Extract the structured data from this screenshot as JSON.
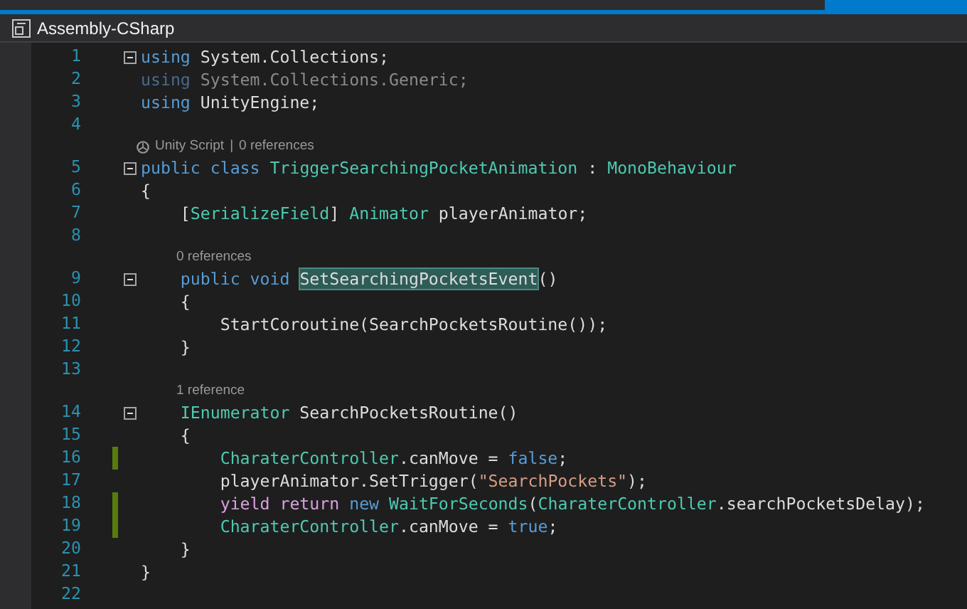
{
  "project_bar": {
    "title": "Assembly-CSharp"
  },
  "lines": [
    {
      "number": "1",
      "fold_marker": true,
      "changed": false,
      "tokens": [
        {
          "kind": "keyword",
          "text": "using"
        },
        {
          "kind": "plain",
          "text": " System.Collections;"
        }
      ]
    },
    {
      "number": "2",
      "fold_marker": false,
      "changed": false,
      "tokens": [
        {
          "kind": "unused",
          "text": "using"
        },
        {
          "kind": "unused_plain",
          "text": " System.Collections.Generic;"
        }
      ]
    },
    {
      "number": "3",
      "fold_marker": false,
      "changed": false,
      "tokens": [
        {
          "kind": "keyword",
          "text": "using"
        },
        {
          "kind": "plain",
          "text": " UnityEngine;"
        }
      ]
    },
    {
      "number": "4",
      "fold_marker": false,
      "changed": false
    },
    {
      "number": "5",
      "fold_marker": true,
      "changed": false,
      "codelens": {
        "unity": true,
        "texts": [
          "Unity Script",
          "|",
          "0 references"
        ]
      },
      "tokens": [
        {
          "kind": "keyword",
          "text": "public class "
        },
        {
          "kind": "type",
          "text": "TriggerSearchingPocketAnimation"
        },
        {
          "kind": "plain",
          "text": " : "
        },
        {
          "kind": "type",
          "text": "MonoBehaviour"
        }
      ]
    },
    {
      "number": "6",
      "fold_marker": false,
      "changed": false,
      "tokens": [
        {
          "kind": "plain",
          "text": "{"
        }
      ]
    },
    {
      "number": "7",
      "fold_marker": false,
      "changed": false,
      "tokens": [
        {
          "kind": "plain",
          "text": "    ["
        },
        {
          "kind": "type",
          "text": "SerializeField"
        },
        {
          "kind": "plain",
          "text": "] "
        },
        {
          "kind": "type",
          "text": "Animator"
        },
        {
          "kind": "plain",
          "text": " playerAnimator;"
        }
      ]
    },
    {
      "number": "8",
      "fold_marker": false,
      "changed": false
    },
    {
      "number": "9",
      "fold_marker": true,
      "changed": false,
      "codelens": {
        "unity": false,
        "texts": [
          "0 references"
        ]
      },
      "tokens": [
        {
          "kind": "keyword",
          "text": "    public void "
        },
        {
          "kind": "plain",
          "text": "SetSearchingPocketsEvent",
          "highlight": true
        },
        {
          "kind": "plain",
          "text": "()"
        }
      ]
    },
    {
      "number": "10",
      "fold_marker": false,
      "changed": false,
      "tokens": [
        {
          "kind": "plain",
          "text": "    {"
        }
      ]
    },
    {
      "number": "11",
      "fold_marker": false,
      "changed": false,
      "tokens": [
        {
          "kind": "plain",
          "text": "        StartCoroutine(SearchPocketsRoutine());"
        }
      ]
    },
    {
      "number": "12",
      "fold_marker": false,
      "changed": false,
      "tokens": [
        {
          "kind": "plain",
          "text": "    }"
        }
      ]
    },
    {
      "number": "13",
      "fold_marker": false,
      "changed": false
    },
    {
      "number": "14",
      "fold_marker": true,
      "changed": false,
      "codelens": {
        "unity": false,
        "texts": [
          "1 reference"
        ]
      },
      "tokens": [
        {
          "kind": "type",
          "text": "    IEnumerator"
        },
        {
          "kind": "plain",
          "text": " SearchPocketsRoutine()"
        }
      ]
    },
    {
      "number": "15",
      "fold_marker": false,
      "changed": false,
      "tokens": [
        {
          "kind": "plain",
          "text": "    {"
        }
      ]
    },
    {
      "number": "16",
      "fold_marker": false,
      "changed": true,
      "tokens": [
        {
          "kind": "type",
          "text": "        CharaterController"
        },
        {
          "kind": "plain",
          "text": ".canMove = "
        },
        {
          "kind": "keyword",
          "text": "false"
        },
        {
          "kind": "plain",
          "text": ";"
        }
      ]
    },
    {
      "number": "17",
      "fold_marker": false,
      "changed": false,
      "tokens": [
        {
          "kind": "plain",
          "text": "        playerAnimator.SetTrigger("
        },
        {
          "kind": "string",
          "text": "\"SearchPockets\""
        },
        {
          "kind": "plain",
          "text": ");"
        }
      ]
    },
    {
      "number": "18",
      "fold_marker": false,
      "changed": true,
      "tokens": [
        {
          "kind": "control",
          "text": "        yield return "
        },
        {
          "kind": "keyword",
          "text": "new "
        },
        {
          "kind": "type",
          "text": "WaitForSeconds"
        },
        {
          "kind": "plain",
          "text": "("
        },
        {
          "kind": "type",
          "text": "CharaterController"
        },
        {
          "kind": "plain",
          "text": ".searchPocketsDelay);"
        }
      ]
    },
    {
      "number": "19",
      "fold_marker": false,
      "changed": true,
      "tokens": [
        {
          "kind": "type",
          "text": "        CharaterController"
        },
        {
          "kind": "plain",
          "text": ".canMove = "
        },
        {
          "kind": "keyword",
          "text": "true"
        },
        {
          "kind": "plain",
          "text": ";"
        }
      ]
    },
    {
      "number": "20",
      "fold_marker": false,
      "changed": false,
      "tokens": [
        {
          "kind": "plain",
          "text": "    }"
        }
      ]
    },
    {
      "number": "21",
      "fold_marker": false,
      "changed": false,
      "tokens": [
        {
          "kind": "plain",
          "text": "}"
        }
      ]
    },
    {
      "number": "22",
      "fold_marker": false,
      "changed": false
    }
  ]
}
